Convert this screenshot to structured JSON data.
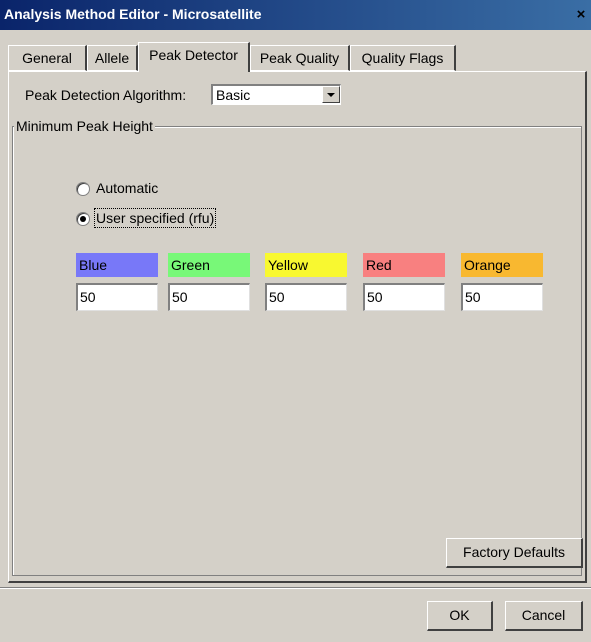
{
  "window": {
    "title": "Analysis Method Editor - Microsatellite",
    "close_glyph": "×"
  },
  "tabs": [
    {
      "label": "General"
    },
    {
      "label": "Allele"
    },
    {
      "label": "Peak Detector",
      "active": true
    },
    {
      "label": "Peak Quality"
    },
    {
      "label": "Quality Flags"
    }
  ],
  "algorithm": {
    "label": "Peak Detection Algorithm:",
    "value": "Basic"
  },
  "min_peak": {
    "group_label": "Minimum Peak Height",
    "options": [
      {
        "label": "Automatic",
        "selected": false
      },
      {
        "label": "User specified (rfu)",
        "selected": true
      }
    ],
    "channels": [
      {
        "name": "Blue",
        "color": "#7878f8",
        "value": "50"
      },
      {
        "name": "Green",
        "color": "#78f878",
        "value": "50"
      },
      {
        "name": "Yellow",
        "color": "#f8f830",
        "value": "50"
      },
      {
        "name": "Red",
        "color": "#f88080",
        "value": "50"
      },
      {
        "name": "Orange",
        "color": "#f8b830",
        "value": "50"
      }
    ]
  },
  "buttons": {
    "factory_defaults": "Factory Defaults",
    "ok": "OK",
    "cancel": "Cancel"
  }
}
